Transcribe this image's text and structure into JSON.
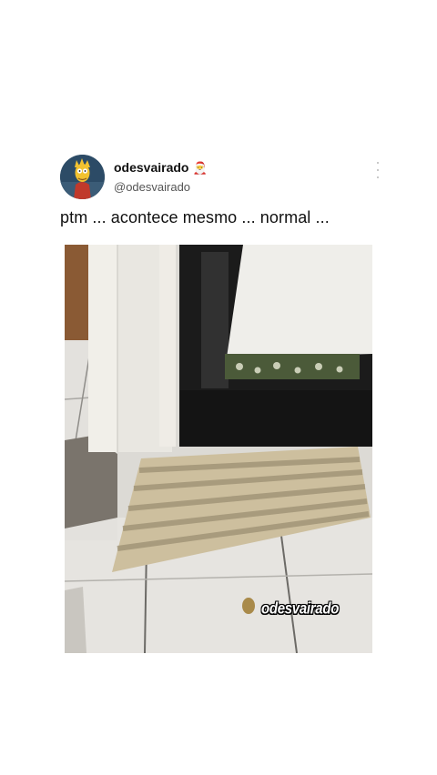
{
  "post": {
    "display_name": "odesvairado",
    "badge_emoji": "🎅",
    "handle": "@odesvairado",
    "text": "ptm ... acontece mesmo ... normal ...",
    "watermark": "odesvairado"
  },
  "icons": {
    "avatar": "cartoon-avatar",
    "menu": "vertical-dots-icon",
    "emoji": "santa-emoji"
  }
}
